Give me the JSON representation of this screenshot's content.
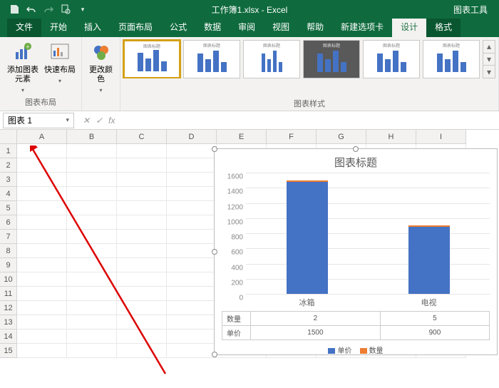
{
  "titlebar": {
    "filename": "工作簿1.xlsx  -  Excel",
    "context_tab": "图表工具"
  },
  "tabs": {
    "file": "文件",
    "items": [
      "开始",
      "插入",
      "页面布局",
      "公式",
      "数据",
      "审阅",
      "视图",
      "帮助",
      "新建选项卡"
    ],
    "design": "设计",
    "format": "格式"
  },
  "ribbon": {
    "layout_group": "图表布局",
    "add_element": "添加图表元素",
    "quick_layout": "快速布局",
    "change_colors": "更改颜色",
    "styles_group": "图表样式"
  },
  "namebox": "图表 1",
  "columns": [
    "A",
    "B",
    "C",
    "D",
    "E",
    "F",
    "G",
    "H",
    "I"
  ],
  "rows": [
    "1",
    "2",
    "3",
    "4",
    "5",
    "6",
    "7",
    "8",
    "9",
    "10",
    "11",
    "12",
    "13",
    "14",
    "15"
  ],
  "chart_data": {
    "type": "bar",
    "title": "图表标题",
    "categories": [
      "冰箱",
      "电视"
    ],
    "series": [
      {
        "name": "单价",
        "values": [
          1500,
          900
        ]
      },
      {
        "name": "数量",
        "values": [
          2,
          5
        ]
      }
    ],
    "ylim": [
      0,
      1600
    ],
    "yticks": [
      0,
      200,
      400,
      600,
      800,
      1000,
      1200,
      1400,
      1600
    ],
    "legend": [
      "单价",
      "数量"
    ],
    "legend_colors": [
      "#4472c4",
      "#ed7d31"
    ],
    "table_rows": [
      {
        "label": "数量",
        "vals": [
          "2",
          "5"
        ]
      },
      {
        "label": "单价",
        "vals": [
          "1500",
          "900"
        ]
      }
    ]
  }
}
